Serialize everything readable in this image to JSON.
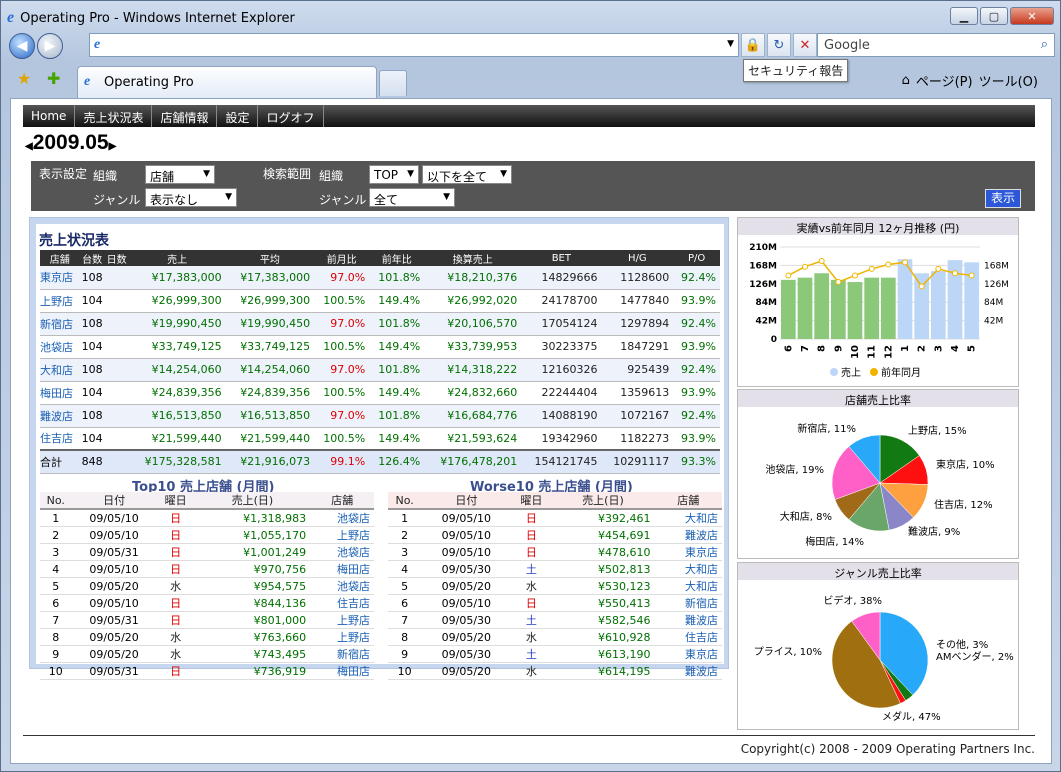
{
  "browser": {
    "title": "Operating Pro - Windows Internet Explorer",
    "search_placeholder": "Google",
    "tab_label": "Operating Pro",
    "tooltip": "セキュリティ報告",
    "page_menu": "ページ(P)",
    "tools_menu": "ツール(O)"
  },
  "nav": [
    "Home",
    "売上状況表",
    "店舗情報",
    "設定",
    "ログオフ"
  ],
  "period": "2009.05",
  "filters": {
    "display_label": "表示設定",
    "org_label": "組織",
    "genre_label": "ジャンル",
    "org_value": "店舗",
    "genre_value": "表示なし",
    "range_label": "検索範囲",
    "range_org_label": "組織",
    "range_org_value": "TOP",
    "range_org_value2": "以下を全て",
    "range_genre_label": "ジャンル",
    "range_genre_value": "全て",
    "show_button": "表示"
  },
  "sales_table": {
    "title": "売上状況表",
    "headers": [
      "店舗",
      "台数",
      "日数",
      "売上",
      "平均",
      "前月比",
      "前年比",
      "換算売上",
      "BET",
      "H/G",
      "P/O"
    ],
    "rows": [
      [
        "東京店",
        "108",
        "",
        "¥17,383,000",
        "¥17,383,000",
        "97.0%",
        "101.8%",
        "¥18,210,376",
        "14829666",
        "1128600",
        "92.4%"
      ],
      [
        "上野店",
        "104",
        "",
        "¥26,999,300",
        "¥26,999,300",
        "100.5%",
        "149.4%",
        "¥26,992,020",
        "24178700",
        "1477840",
        "93.9%"
      ],
      [
        "新宿店",
        "108",
        "",
        "¥19,990,450",
        "¥19,990,450",
        "97.0%",
        "101.8%",
        "¥20,106,570",
        "17054124",
        "1297894",
        "92.4%"
      ],
      [
        "池袋店",
        "104",
        "",
        "¥33,749,125",
        "¥33,749,125",
        "100.5%",
        "149.4%",
        "¥33,739,953",
        "30223375",
        "1847291",
        "93.9%"
      ],
      [
        "大和店",
        "108",
        "",
        "¥14,254,060",
        "¥14,254,060",
        "97.0%",
        "101.8%",
        "¥14,318,222",
        "12160326",
        "925439",
        "92.4%"
      ],
      [
        "梅田店",
        "104",
        "",
        "¥24,839,356",
        "¥24,839,356",
        "100.5%",
        "149.4%",
        "¥24,832,660",
        "22244404",
        "1359613",
        "93.9%"
      ],
      [
        "難波店",
        "108",
        "",
        "¥16,513,850",
        "¥16,513,850",
        "97.0%",
        "101.8%",
        "¥16,684,776",
        "14088190",
        "1072167",
        "92.4%"
      ],
      [
        "住吉店",
        "104",
        "",
        "¥21,599,440",
        "¥21,599,440",
        "100.5%",
        "149.4%",
        "¥21,593,624",
        "19342960",
        "1182273",
        "93.9%"
      ]
    ],
    "total": [
      "合計",
      "848",
      "",
      "¥175,328,581",
      "¥21,916,073",
      "99.1%",
      "126.4%",
      "¥176,478,201",
      "154121745",
      "10291117",
      "93.3%"
    ]
  },
  "top10": {
    "title": "Top10 売上店舗 (月間)",
    "headers": [
      "No.",
      "日付",
      "曜日",
      "売上(日)",
      "店舗"
    ],
    "rows": [
      [
        "1",
        "09/05/10",
        "日",
        "¥1,318,983",
        "池袋店"
      ],
      [
        "2",
        "09/05/10",
        "日",
        "¥1,055,170",
        "上野店"
      ],
      [
        "3",
        "09/05/31",
        "日",
        "¥1,001,249",
        "池袋店"
      ],
      [
        "4",
        "09/05/10",
        "日",
        "¥970,756",
        "梅田店"
      ],
      [
        "5",
        "09/05/20",
        "水",
        "¥954,575",
        "池袋店"
      ],
      [
        "6",
        "09/05/10",
        "日",
        "¥844,136",
        "住吉店"
      ],
      [
        "7",
        "09/05/31",
        "日",
        "¥801,000",
        "上野店"
      ],
      [
        "8",
        "09/05/20",
        "水",
        "¥763,660",
        "上野店"
      ],
      [
        "9",
        "09/05/20",
        "水",
        "¥743,495",
        "新宿店"
      ],
      [
        "10",
        "09/05/31",
        "日",
        "¥736,919",
        "梅田店"
      ]
    ]
  },
  "worse10": {
    "title": "Worse10 売上店舗 (月間)",
    "headers": [
      "No.",
      "日付",
      "曜日",
      "売上(日)",
      "店舗"
    ],
    "rows": [
      [
        "1",
        "09/05/10",
        "日",
        "¥392,461",
        "大和店"
      ],
      [
        "2",
        "09/05/10",
        "日",
        "¥454,691",
        "難波店"
      ],
      [
        "3",
        "09/05/10",
        "日",
        "¥478,610",
        "東京店"
      ],
      [
        "4",
        "09/05/30",
        "土",
        "¥502,813",
        "大和店"
      ],
      [
        "5",
        "09/05/20",
        "水",
        "¥530,123",
        "大和店"
      ],
      [
        "6",
        "09/05/10",
        "日",
        "¥550,413",
        "新宿店"
      ],
      [
        "7",
        "09/05/30",
        "土",
        "¥582,546",
        "難波店"
      ],
      [
        "8",
        "09/05/20",
        "水",
        "¥610,928",
        "住吉店"
      ],
      [
        "9",
        "09/05/30",
        "土",
        "¥613,190",
        "東京店"
      ],
      [
        "10",
        "09/05/20",
        "水",
        "¥614,195",
        "難波店"
      ]
    ]
  },
  "chart_data": [
    {
      "type": "bar",
      "title": "実績vs前年同月 12ヶ月推移 (円)",
      "categories": [
        "6",
        "7",
        "8",
        "9",
        "10",
        "11",
        "12",
        "1",
        "2",
        "3",
        "4",
        "5"
      ],
      "ylim": [
        0,
        210
      ],
      "yticks": [
        "0",
        "42M",
        "84M",
        "126M",
        "168M",
        "210M"
      ],
      "yticks_right": [
        "42M",
        "84M",
        "126M",
        "168M"
      ],
      "series": [
        {
          "name": "売上",
          "values": [
            135,
            140,
            150,
            135,
            130,
            140,
            140,
            182,
            150,
            155,
            180,
            175
          ],
          "highlight_first": 7,
          "color_first": "#8cc87a",
          "color_rest": "#bcd6f8"
        },
        {
          "name": "前年同月",
          "values": [
            145,
            165,
            178,
            130,
            145,
            160,
            170,
            175,
            120,
            160,
            150,
            145
          ],
          "color": "#f0b400"
        }
      ]
    },
    {
      "type": "pie",
      "title": "店舗売上比率",
      "slices": [
        {
          "label": "上野店, 15%",
          "value": 15,
          "color": "#127a12"
        },
        {
          "label": "東京店, 10%",
          "value": 10,
          "color": "#ff1010"
        },
        {
          "label": "住吉店, 12%",
          "value": 12,
          "color": "#ffa040"
        },
        {
          "label": "難波店, 9%",
          "value": 9,
          "color": "#8a86c8"
        },
        {
          "label": "梅田店, 14%",
          "value": 14,
          "color": "#6aa66a"
        },
        {
          "label": "大和店, 8%",
          "value": 8,
          "color": "#a06a18"
        },
        {
          "label": "池袋店, 19%",
          "value": 19,
          "color": "#ff60c8"
        },
        {
          "label": "新宿店, 11%",
          "value": 11,
          "color": "#28a8f8"
        }
      ]
    },
    {
      "type": "pie",
      "title": "ジャンル売上比率",
      "slices": [
        {
          "label": "ビデオ, 38%",
          "value": 38,
          "color": "#28a8f8"
        },
        {
          "label": "その他, 3%",
          "value": 3,
          "color": "#127a12"
        },
        {
          "label": "AMベンダー, 2%",
          "value": 2,
          "color": "#ff1010"
        },
        {
          "label": "メダル, 47%",
          "value": 47,
          "color": "#a07010"
        },
        {
          "label": "プライス, 10%",
          "value": 10,
          "color": "#ff60c8"
        }
      ]
    }
  ],
  "footer": "Copyright(c) 2008 - 2009 Operating Partners Inc."
}
